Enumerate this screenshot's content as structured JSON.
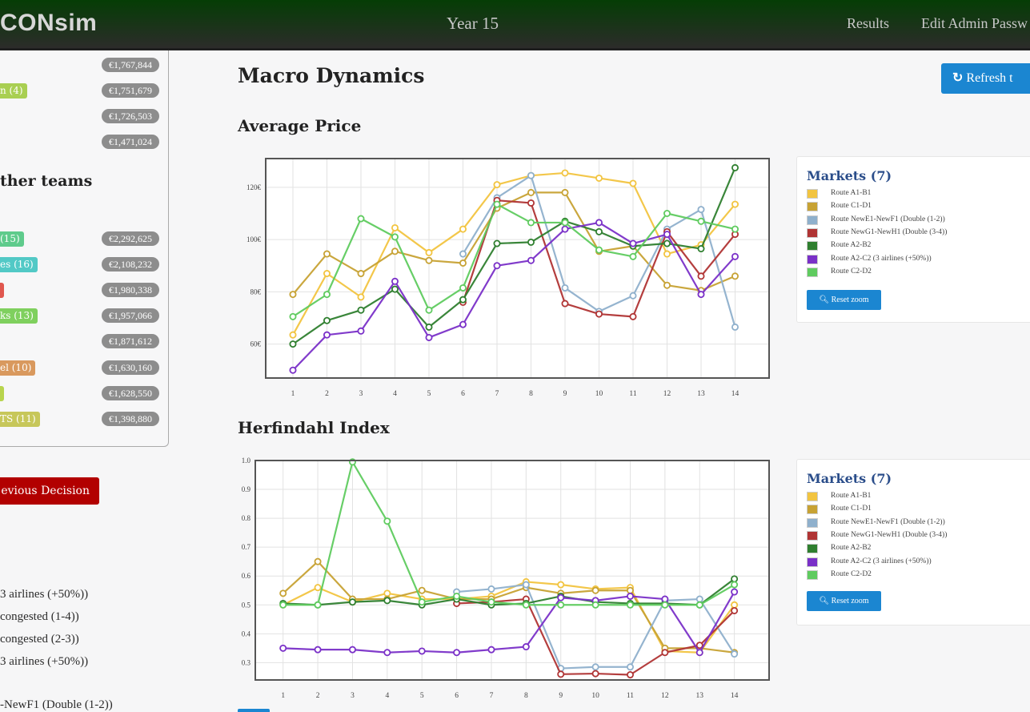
{
  "nav": {
    "brand": "CONsim",
    "year": "Year 15",
    "links": [
      "Results",
      "Edit Admin Passw"
    ]
  },
  "sidebar": {
    "top_rows": [
      {
        "label": "",
        "color": "",
        "value": "€1,767,844"
      },
      {
        "label": "n (4)",
        "color": "#a9cf52",
        "value": "€1,751,679"
      },
      {
        "label": "",
        "color": "",
        "value": "€1,726,503"
      },
      {
        "label": "",
        "color": "",
        "value": "€1,471,024"
      }
    ],
    "other_teams_heading": "ther teams",
    "other_rows": [
      {
        "label": "(15)",
        "color": "#5fcb8c",
        "value": "€2,292,625"
      },
      {
        "label": "es (16)",
        "color": "#52c9c6",
        "value": "€2,108,232"
      },
      {
        "label": " ",
        "color": "#e0574f",
        "value": "€1,980,338"
      },
      {
        "label": "ks (13)",
        "color": "#7fd05e",
        "value": "€1,957,066"
      },
      {
        "label": "",
        "color": "",
        "value": "€1,871,612"
      },
      {
        "label": "el (10)",
        "color": "#d9995e",
        "value": "€1,630,160"
      },
      {
        "label": " ",
        "color": "#b8d44e",
        "value": "€1,628,550"
      },
      {
        "label": "TS (11)",
        "color": "#c7c75a",
        "value": "€1,398,880"
      }
    ],
    "prev_decision_button": "evious Decision",
    "route_lines": [
      "3 airlines (+50%))",
      "congested (1-4))",
      "congested (2-3))",
      "3 airlines (+50%))",
      "-NewF1 (Double (1-2))"
    ]
  },
  "main": {
    "title": "Macro Dynamics",
    "refresh_button": "Refresh t",
    "refresh_icon": "refresh-icon",
    "reset_zoom_label": "Reset zoom",
    "reset_zoom_icon": "search-icon",
    "legend_title": "Markets (7)"
  },
  "series_meta": [
    {
      "name": "Route A1-B1",
      "color": "#f2c440"
    },
    {
      "name": "Route C1-D1",
      "color": "#c7a234"
    },
    {
      "name": "Route NewE1-NewF1 (Double (1-2))",
      "color": "#8fb0cc"
    },
    {
      "name": "Route NewG1-NewH1 (Double (3-4))",
      "color": "#b03434"
    },
    {
      "name": "Route A2-B2",
      "color": "#2f7f2f"
    },
    {
      "name": "Route A2-C2 (3 airlines (+50%))",
      "color": "#7a30c8"
    },
    {
      "name": "Route C2-D2",
      "color": "#5fcb5f"
    }
  ],
  "chart_data": [
    {
      "type": "line",
      "title": "Average Price",
      "xlabel": "",
      "ylabel": "",
      "x": [
        1,
        2,
        3,
        4,
        5,
        6,
        7,
        8,
        9,
        10,
        11,
        12,
        13,
        14
      ],
      "xlim": [
        0.2,
        15.0
      ],
      "ylim": [
        47,
        131
      ],
      "yticks": [
        60,
        80,
        100,
        120
      ],
      "ytick_labels": [
        "60€",
        "80€",
        "100€",
        "120€"
      ],
      "grid": true,
      "legend": "right",
      "series": [
        {
          "name": "Route A1-B1",
          "values": [
            63.5,
            87,
            78,
            104.5,
            95,
            104,
            121,
            124.5,
            125.5,
            123.5,
            121.5,
            94.5,
            98,
            113.5
          ]
        },
        {
          "name": "Route C1-D1",
          "values": [
            79,
            94.5,
            87,
            95.5,
            92,
            91,
            112,
            118,
            118,
            95.5,
            97.5,
            82.5,
            80.5,
            86
          ]
        },
        {
          "name": "Route NewE1-NewF1 (Double (1-2))",
          "values": [
            null,
            null,
            null,
            null,
            null,
            94.5,
            116,
            124.5,
            81.5,
            72.5,
            78.5,
            104,
            111.5,
            66.5
          ]
        },
        {
          "name": "Route NewG1-NewH1 (Double (3-4))",
          "values": [
            null,
            null,
            null,
            null,
            null,
            76,
            115,
            114,
            75.5,
            71.5,
            70.5,
            103,
            86,
            102
          ]
        },
        {
          "name": "Route A2-B2",
          "values": [
            60,
            69,
            73,
            81,
            66.5,
            77,
            98.5,
            99,
            107,
            103,
            97.5,
            98.5,
            96.5,
            127.5
          ]
        },
        {
          "name": "Route A2-C2 (3 airlines (+50%))",
          "values": [
            50,
            63.5,
            65,
            84,
            62.5,
            67.5,
            90,
            92,
            104,
            106.5,
            98.5,
            102,
            79,
            93.5
          ]
        },
        {
          "name": "Route C2-D2",
          "values": [
            70.5,
            79,
            108,
            101,
            73,
            81.5,
            113.5,
            106.5,
            106.5,
            96,
            93.5,
            110,
            107,
            104
          ]
        }
      ]
    },
    {
      "type": "line",
      "title": "Herfindahl Index",
      "xlabel": "",
      "ylabel": "",
      "x": [
        1,
        2,
        3,
        4,
        5,
        6,
        7,
        8,
        9,
        10,
        11,
        12,
        13,
        14
      ],
      "xlim": [
        0.2,
        15.0
      ],
      "ylim": [
        0.24,
        1.0
      ],
      "yticks": [
        0.3,
        0.4,
        0.5,
        0.6,
        0.7,
        0.8,
        0.9,
        1.0
      ],
      "ytick_labels": [
        "0.3",
        "0.4",
        "0.5",
        "0.6",
        "0.7",
        "0.8",
        "0.9",
        "1.0"
      ],
      "grid": true,
      "legend": "right",
      "series": [
        {
          "name": "Route A1-B1",
          "values": [
            0.5,
            0.56,
            0.51,
            0.54,
            0.52,
            0.52,
            0.53,
            0.58,
            0.57,
            0.555,
            0.56,
            0.34,
            0.335,
            0.5
          ]
        },
        {
          "name": "Route C1-D1",
          "values": [
            0.54,
            0.65,
            0.52,
            0.52,
            0.55,
            0.52,
            0.52,
            0.56,
            0.54,
            0.55,
            0.55,
            0.35,
            0.35,
            0.335
          ]
        },
        {
          "name": "Route NewE1-NewF1 (Double (1-2))",
          "values": [
            null,
            null,
            null,
            null,
            null,
            0.545,
            0.555,
            0.57,
            0.28,
            0.285,
            0.285,
            0.515,
            0.52,
            0.33
          ]
        },
        {
          "name": "Route NewG1-NewH1 (Double (3-4))",
          "values": [
            null,
            null,
            null,
            null,
            null,
            0.505,
            0.51,
            0.52,
            0.26,
            0.262,
            0.258,
            0.335,
            0.36,
            0.48
          ]
        },
        {
          "name": "Route A2-B2",
          "values": [
            0.505,
            0.5,
            0.51,
            0.515,
            0.5,
            0.52,
            0.5,
            0.505,
            0.53,
            0.51,
            0.505,
            0.505,
            0.5,
            0.59
          ]
        },
        {
          "name": "Route A2-C2 (3 airlines (+50%))",
          "values": [
            0.35,
            0.345,
            0.345,
            0.335,
            0.34,
            0.335,
            0.345,
            0.355,
            0.525,
            0.515,
            0.53,
            0.52,
            0.335,
            0.545
          ]
        },
        {
          "name": "Route C2-D2",
          "values": [
            0.5,
            0.5,
            0.995,
            0.79,
            0.51,
            0.53,
            0.51,
            0.5,
            0.5,
            0.5,
            0.5,
            0.5,
            0.5,
            0.57
          ]
        }
      ]
    }
  ]
}
